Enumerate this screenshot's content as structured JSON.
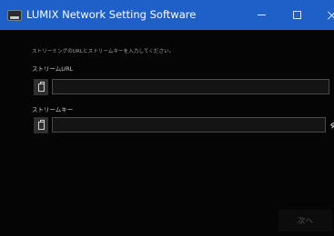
{
  "window": {
    "title": "LUMIX Network Setting Software",
    "titlebar_color": "#1e60c8",
    "icons": {
      "app": "lumix-app-icon",
      "minimize": "minimize-icon",
      "maximize": "maximize-icon",
      "close": "close-icon"
    }
  },
  "form": {
    "description": "ストリーミングのURLとストリームキーを入力してください。",
    "stream_url": {
      "label": "ストリームURL",
      "value": "",
      "paste_icon": "paste-icon"
    },
    "stream_key": {
      "label": "ストリームキー",
      "value": "",
      "paste_icon": "paste-icon",
      "visibility_icon": "eye-hidden-icon"
    }
  },
  "footer": {
    "next_label": "次へ"
  }
}
